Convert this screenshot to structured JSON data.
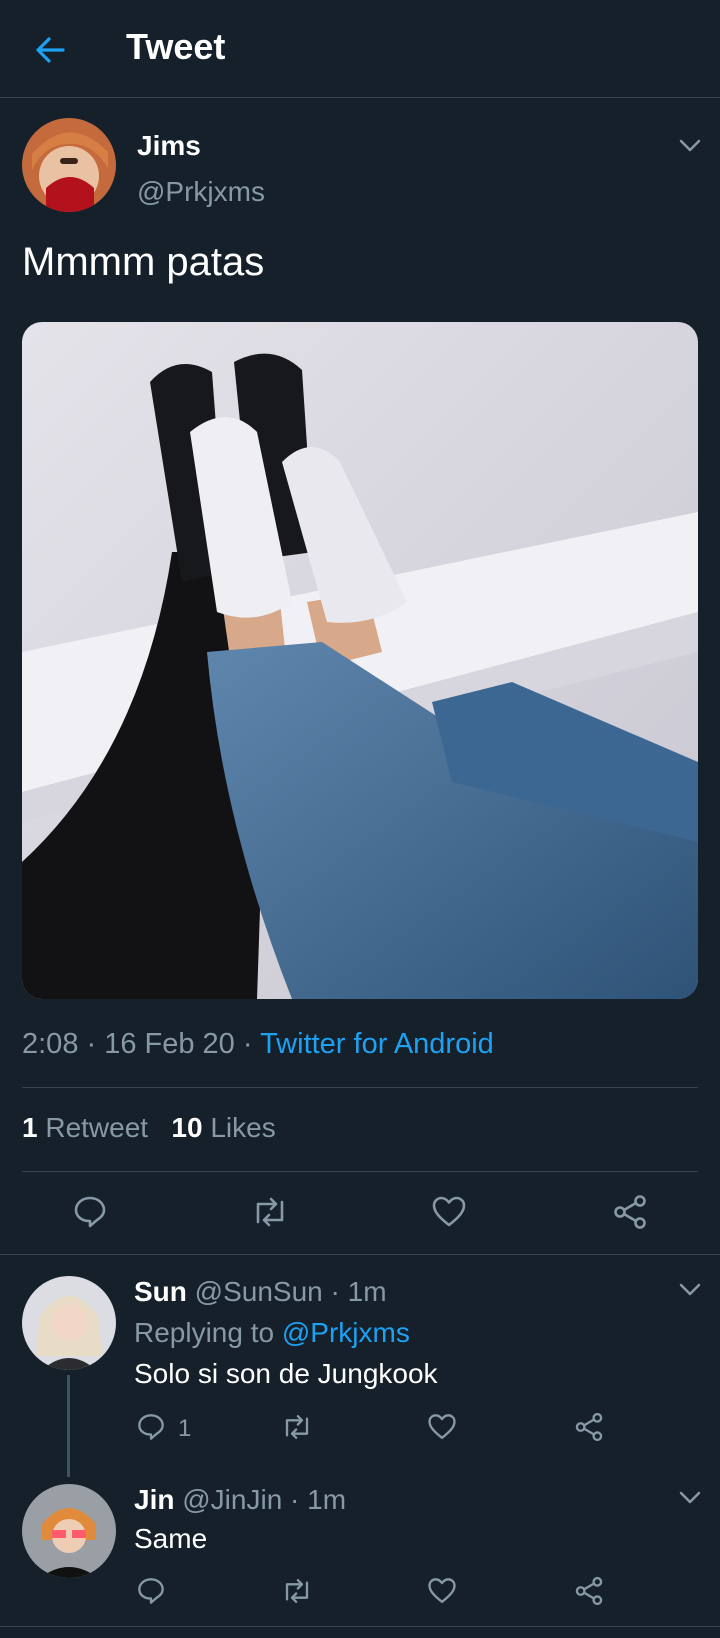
{
  "header": {
    "title": "Tweet"
  },
  "tweet": {
    "name": "Jims",
    "handle": "@Prkjxms",
    "text": "Mmmm patas",
    "time_date": "2:08 · 16 Feb 20 · ",
    "source": "Twitter for Android",
    "retweets": {
      "count": "1",
      "label": "Retweet"
    },
    "likes": {
      "count": "10",
      "label": "Likes"
    }
  },
  "replies": [
    {
      "name": "Sun",
      "handle_time": "@SunSun · 1m",
      "replying_prefix": "Replying to ",
      "replying_handle": "@Prkjxms",
      "text": "Solo si son de Jungkook",
      "reply_count": "1"
    },
    {
      "name": "Jin",
      "handle_time": "@JinJin · 1m",
      "text": "Same"
    }
  ],
  "colors": {
    "background": "#15202b",
    "accent": "#1da1f2",
    "secondary_text": "#8899a6",
    "divider": "#38444d"
  },
  "icons": [
    "back-arrow-icon",
    "chevron-down-icon",
    "reply-icon",
    "retweet-icon",
    "like-icon",
    "share-icon"
  ]
}
